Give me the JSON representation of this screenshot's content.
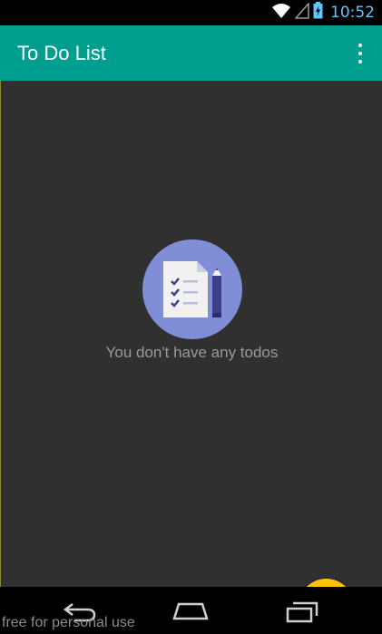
{
  "status_bar": {
    "time": "10:52",
    "icons": [
      "wifi-icon",
      "signal-icon",
      "battery-charging-icon"
    ],
    "time_color": "#5fc6ff"
  },
  "app_bar": {
    "title": "To Do List",
    "menu_icon": "overflow-menu-icon",
    "background": "#009e8e"
  },
  "empty_state": {
    "icon": "checklist-pencil-icon",
    "message": "You don't have any todos",
    "circle_color": "#7f8ed6"
  },
  "fab": {
    "icon": "plus-icon",
    "label": "+",
    "color": "#ffc107"
  },
  "nav_bar": {
    "buttons": [
      "back-icon",
      "home-icon",
      "recent-apps-icon"
    ]
  },
  "watermark": {
    "text": "free for personal use"
  }
}
